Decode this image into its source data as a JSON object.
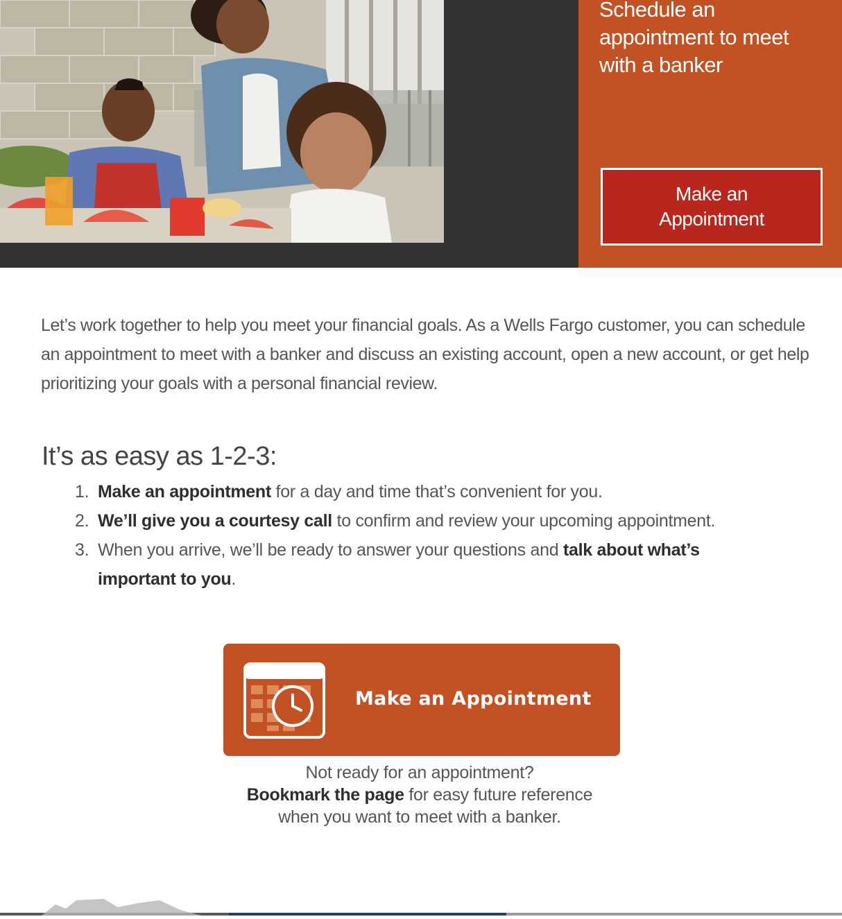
{
  "hero": {
    "promo_heading": "Schedule an appointment to meet with a banker",
    "promo_button_label": "Make an Appointment"
  },
  "intro": "Let’s work together to help you meet your financial goals. As a Wells Fargo customer, you can schedule an appointment to meet with a banker and discuss an existing account, open a new account, or get help prioritizing your goals with a personal financial review.",
  "steps": {
    "heading": "It’s as easy as 1-2-3:",
    "items": [
      {
        "number": "1.",
        "bold": "Make an appointment",
        "text": " for a day and time that’s convenient for you."
      },
      {
        "number": "2.",
        "bold": "We’ll give you a courtesy call",
        "text": " to confirm and review your upcoming appointment."
      },
      {
        "number": "3.",
        "text": "When you arrive, we’ll be ready to answer your questions and ",
        "bold": "talk about what’s important to you",
        "end": "."
      }
    ]
  },
  "cta": {
    "label": "Make an Appointment",
    "icon": "calendar-clock-icon"
  },
  "note": {
    "line1": "Not ready for an appointment?",
    "bold": "Bookmark the page",
    "line2": " for easy future reference",
    "line3": "when you want to meet with a banker."
  },
  "colors": {
    "accent_orange": "#c25223",
    "button_red": "#b8261d",
    "hero_dark": "#333333"
  }
}
